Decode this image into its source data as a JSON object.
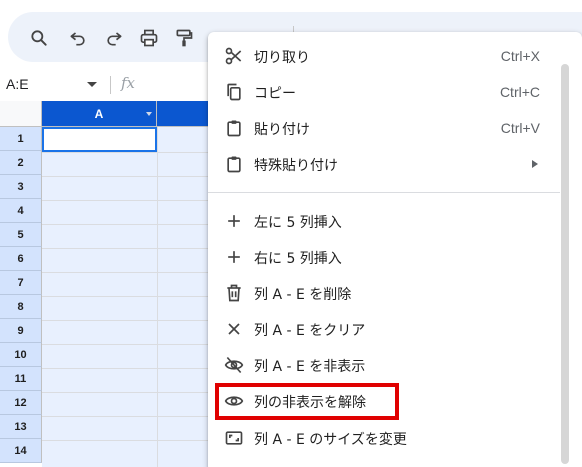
{
  "toolbar": {
    "buttons": [
      {
        "name": "search-icon"
      },
      {
        "name": "undo-icon"
      },
      {
        "name": "redo-icon"
      },
      {
        "name": "print-icon"
      },
      {
        "name": "paint-format-icon"
      }
    ]
  },
  "formula_bar": {
    "name_box": "A:E",
    "fx_label": "fx"
  },
  "grid": {
    "columns": [
      "A",
      ""
    ],
    "rows": [
      "1",
      "2",
      "3",
      "4",
      "5",
      "6",
      "7",
      "8",
      "9",
      "10",
      "11",
      "12",
      "13",
      "14"
    ]
  },
  "context_menu": {
    "items": [
      {
        "icon": "cut-icon",
        "label": "切り取り",
        "shortcut": "Ctrl+X"
      },
      {
        "icon": "copy-icon",
        "label": "コピー",
        "shortcut": "Ctrl+C"
      },
      {
        "icon": "paste-icon",
        "label": "貼り付け",
        "shortcut": "Ctrl+V"
      },
      {
        "icon": "paste-special-icon",
        "label": "特殊貼り付け",
        "shortcut": ""
      },
      {
        "icon": "plus-icon",
        "label": "左に 5 列挿入",
        "shortcut": ""
      },
      {
        "icon": "plus-icon",
        "label": "右に 5 列挿入",
        "shortcut": ""
      },
      {
        "icon": "trash-icon",
        "label": "列 A - E を削除",
        "shortcut": ""
      },
      {
        "icon": "clear-x-icon",
        "label": "列 A - E をクリア",
        "shortcut": ""
      },
      {
        "icon": "eye-off-icon",
        "label": "列 A - E を非表示",
        "shortcut": ""
      },
      {
        "icon": "eye-icon",
        "label": "列の非表示を解除",
        "shortcut": ""
      },
      {
        "icon": "resize-icon",
        "label": "列 A - E のサイズを変更",
        "shortcut": ""
      }
    ]
  },
  "colors": {
    "selection_header": "#0b57d0",
    "selection_fill": "#e8f0fe",
    "highlight_box": "#e00000"
  }
}
